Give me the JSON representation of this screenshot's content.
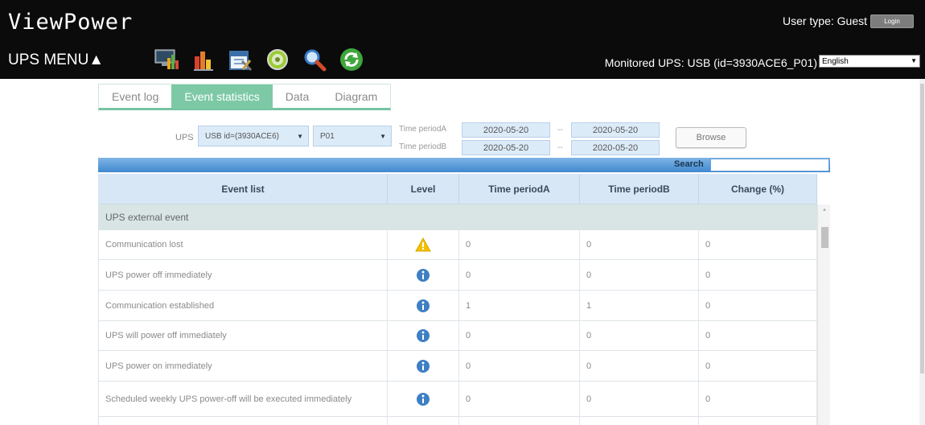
{
  "header": {
    "logo": "ViewPower",
    "menu_label": "UPS MENU▲",
    "user_type": "User type: Guest",
    "login_label": "Login",
    "monitored": "Monitored UPS: USB (id=3930ACE6_P01)",
    "language": "English",
    "toolbar_icons": [
      "monitor-chart-icon",
      "bar-chart-icon",
      "calendar-tools-icon",
      "settings-disc-icon",
      "magnifier-icon",
      "refresh-icon"
    ]
  },
  "tabs": [
    {
      "label": "Event log",
      "active": false
    },
    {
      "label": "Event statistics",
      "active": true
    },
    {
      "label": "Data",
      "active": false
    },
    {
      "label": "Diagram",
      "active": false
    }
  ],
  "filter": {
    "ups_label": "UPS",
    "ups_select": "USB id=(3930ACE6)",
    "port_select": "P01",
    "period_a_label": "Time periodA",
    "period_b_label": "Time periodB",
    "period_a_from": "2020-05-20",
    "period_a_to": "2020-05-20",
    "period_b_from": "2020-05-20",
    "period_b_to": "2020-05-20",
    "separator": "--",
    "browse_label": "Browse"
  },
  "search": {
    "label": "Search",
    "value": ""
  },
  "table": {
    "headers": {
      "event": "Event list",
      "level": "Level",
      "a": "Time periodA",
      "b": "Time periodB",
      "change": "Change (%)"
    },
    "group": "UPS external event",
    "rows": [
      {
        "event": "Communication lost",
        "level": "warning",
        "a": "0",
        "b": "0",
        "change": "0"
      },
      {
        "event": "UPS power off immediately",
        "level": "info",
        "a": "0",
        "b": "0",
        "change": "0"
      },
      {
        "event": "Communication established",
        "level": "info",
        "a": "1",
        "b": "1",
        "change": "0"
      },
      {
        "event": "UPS will power off immediately",
        "level": "info",
        "a": "0",
        "b": "0",
        "change": "0"
      },
      {
        "event": "UPS power on immediately",
        "level": "info",
        "a": "0",
        "b": "0",
        "change": "0"
      },
      {
        "event": "Scheduled weekly UPS power-off will be executed immediately",
        "level": "info",
        "a": "0",
        "b": "0",
        "change": "0"
      }
    ]
  },
  "colors": {
    "header_bg": "#0b0b0b",
    "tab_active": "#7dc9a6",
    "search_bar": "#3f89cf",
    "table_header": "#d7e7f6",
    "group_row": "#d8e5e4",
    "warning": "#f2c200",
    "info": "#3e7fc4"
  }
}
